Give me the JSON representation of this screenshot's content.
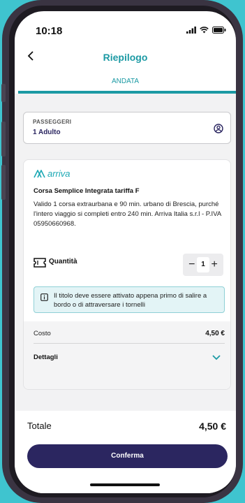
{
  "status_bar": {
    "time": "10:18"
  },
  "header": {
    "title": "Riepilogo"
  },
  "tab": {
    "label": "ANDATA"
  },
  "passengers": {
    "label": "PASSEGGERI",
    "value": "1 Adulto"
  },
  "ticket": {
    "operator_logo_text": "arriva",
    "title": "Corsa Semplice Integrata tariffa F",
    "description": "Valido 1 corsa extraurbana e 90 min. urbano di Brescia, purché l'intero viaggio si completi entro 240 min. Arriva Italia s.r.l  - P.IVA 05950660968.",
    "quantity_label": "Quantità",
    "quantity_value": "1",
    "decrement": "−",
    "increment": "+",
    "info": "Il titolo deve essere attivato appena primo di salire a bordo o di attraversare i tornelli",
    "cost_label": "Costo",
    "cost_value": "4,50 €",
    "details_label": "Dettagli"
  },
  "footer": {
    "total_label": "Totale",
    "total_value": "4,50 €",
    "confirm_label": "Conferma"
  },
  "colors": {
    "accent": "#1c9aa4",
    "primary": "#2b2660",
    "background": "#3fc4cf"
  },
  "icons": [
    "signal-icon",
    "wifi-icon",
    "battery-icon",
    "back-icon",
    "user-icon",
    "ticket-icon",
    "info-icon",
    "chevron-down-icon"
  ]
}
